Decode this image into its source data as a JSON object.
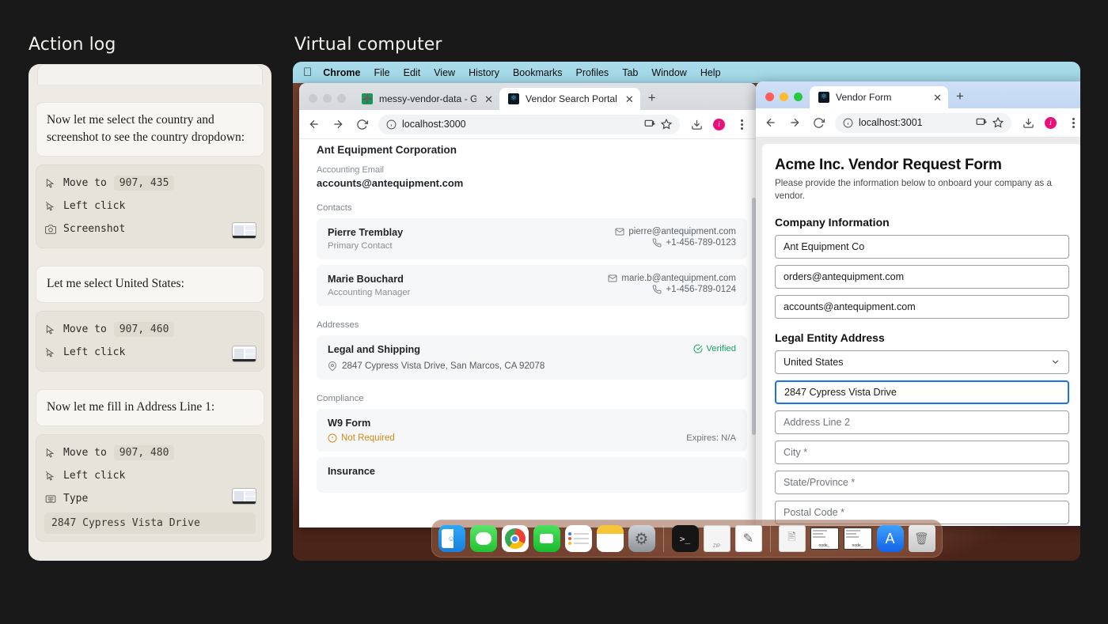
{
  "panels": {
    "action_log_title": "Action log",
    "virtual_computer_title": "Virtual computer"
  },
  "action_log": {
    "entries": [
      {
        "type": "say",
        "text": "Now let me select the country and screenshot to see the country dropdown:"
      },
      {
        "type": "actions",
        "has_thumbnail": true,
        "rows": [
          {
            "icon": "cursor-icon",
            "label": "Move to",
            "value": "907, 435"
          },
          {
            "icon": "click-icon",
            "label": "Left click",
            "value": ""
          },
          {
            "icon": "camera-icon",
            "label": "Screenshot",
            "value": ""
          }
        ]
      },
      {
        "type": "say",
        "text": "Let me select United States:"
      },
      {
        "type": "actions",
        "has_thumbnail": true,
        "rows": [
          {
            "icon": "cursor-icon",
            "label": "Move to",
            "value": "907, 460"
          },
          {
            "icon": "click-icon",
            "label": "Left click",
            "value": ""
          }
        ]
      },
      {
        "type": "say",
        "text": "Now let me fill in Address Line 1:"
      },
      {
        "type": "actions",
        "has_thumbnail": true,
        "rows": [
          {
            "icon": "cursor-icon",
            "label": "Move to",
            "value": "907, 480"
          },
          {
            "icon": "click-icon",
            "label": "Left click",
            "value": ""
          },
          {
            "icon": "keyboard-icon",
            "label": "Type",
            "value": ""
          }
        ],
        "typed_text": "2847 Cypress Vista Drive"
      }
    ]
  },
  "menubar": {
    "apple": "",
    "items": [
      "Chrome",
      "File",
      "Edit",
      "View",
      "History",
      "Bookmarks",
      "Profiles",
      "Tab",
      "Window",
      "Help"
    ]
  },
  "window1": {
    "tabs": [
      {
        "label": "messy-vendor-data - Google",
        "favicon": "sheets-icon",
        "active": false
      },
      {
        "label": "Vendor Search Portal",
        "favicon": "portal-icon",
        "active": true
      }
    ],
    "new_tab_label": "+",
    "close_label": "✕",
    "url": "localhost:3000",
    "page": {
      "company": "Ant Equipment Corporation",
      "accounting_email_label": "Accounting Email",
      "accounting_email": "accounts@antequipment.com",
      "contacts_label": "Contacts",
      "contacts": [
        {
          "name": "Pierre Tremblay",
          "role": "Primary Contact",
          "email": "pierre@antequipment.com",
          "phone": "+1-456-789-0123"
        },
        {
          "name": "Marie Bouchard",
          "role": "Accounting Manager",
          "email": "marie.b@antequipment.com",
          "phone": "+1-456-789-0124"
        }
      ],
      "addresses_label": "Addresses",
      "address": {
        "title": "Legal and Shipping",
        "status": "Verified",
        "line": "2847 Cypress Vista Drive, San Marcos, CA 92078"
      },
      "compliance_label": "Compliance",
      "compliance": [
        {
          "title": "W9 Form",
          "status": "Not Required",
          "expires": "Expires: N/A"
        }
      ],
      "next_section": "Insurance"
    }
  },
  "window2": {
    "tabs": [
      {
        "label": "Vendor Form",
        "favicon": "portal-icon",
        "active": true
      }
    ],
    "new_tab_label": "+",
    "close_label": "✕",
    "url": "localhost:3001",
    "form": {
      "title": "Acme Inc. Vendor Request Form",
      "subtitle": "Please provide the information below to onboard your company as a vendor.",
      "section_company": "Company Information",
      "company_fields": [
        {
          "value": "Ant Equipment Co",
          "placeholder": "",
          "state": "filled"
        },
        {
          "value": "orders@antequipment.com",
          "placeholder": "",
          "state": "filled"
        },
        {
          "value": "accounts@antequipment.com",
          "placeholder": "",
          "state": "filled"
        }
      ],
      "section_address": "Legal Entity Address",
      "country_value": "United States",
      "address_fields": [
        {
          "value": "2847 Cypress Vista Drive",
          "placeholder": "",
          "state": "focused"
        },
        {
          "value": "",
          "placeholder": "Address Line 2",
          "state": "empty"
        },
        {
          "value": "",
          "placeholder": "City *",
          "state": "empty"
        },
        {
          "value": "",
          "placeholder": "State/Province *",
          "state": "empty"
        },
        {
          "value": "",
          "placeholder": "Postal Code *",
          "state": "empty"
        }
      ]
    }
  },
  "dock": {
    "items": [
      {
        "name": "finder-icon",
        "glyph": "■",
        "color": "#1f9bef"
      },
      {
        "name": "messages-icon",
        "glyph": "●",
        "color": "#3ecf4a"
      },
      {
        "name": "chrome-icon",
        "glyph": "●",
        "color": "#ffffff"
      },
      {
        "name": "facetime-icon",
        "glyph": "■",
        "color": "#2fd24f"
      },
      {
        "name": "reminders-icon",
        "glyph": "≡",
        "color": "#ffffff"
      },
      {
        "name": "notes-icon",
        "glyph": "▬",
        "color": "#fdc943"
      },
      {
        "name": "settings-icon",
        "glyph": "⚙",
        "color": "#9aa0a6"
      },
      {
        "name": "separator",
        "glyph": "",
        "color": ""
      },
      {
        "name": "terminal-icon",
        "glyph": "⌫",
        "color": "#1c1c1c"
      },
      {
        "name": "zip-file-icon",
        "glyph": "□",
        "color": "#f2f2f2"
      },
      {
        "name": "textedit-icon",
        "glyph": "✎",
        "color": "#ffffff"
      },
      {
        "name": "separator",
        "glyph": "",
        "color": ""
      },
      {
        "name": "document-icon",
        "glyph": "□",
        "color": "#f2f2f2"
      },
      {
        "name": "node-window-icon",
        "glyph": "",
        "color": "#ffffff",
        "label": "node_"
      },
      {
        "name": "node-window-icon-2",
        "glyph": "",
        "color": "#ffffff",
        "label": "node_"
      },
      {
        "name": "app-store-icon",
        "glyph": "A",
        "color": "#1f86f9"
      },
      {
        "name": "trash-icon",
        "glyph": "Ὕ1",
        "color": "#d7d7d7"
      }
    ]
  },
  "colors": {
    "background": "#191919",
    "menubar": "#a9dcea",
    "accent_focus": "#1a73e8",
    "verified_green": "#19a463",
    "warn_amber": "#d28a12",
    "profile_pink": "#ec0f7a",
    "log_panel": "#edebe4"
  }
}
